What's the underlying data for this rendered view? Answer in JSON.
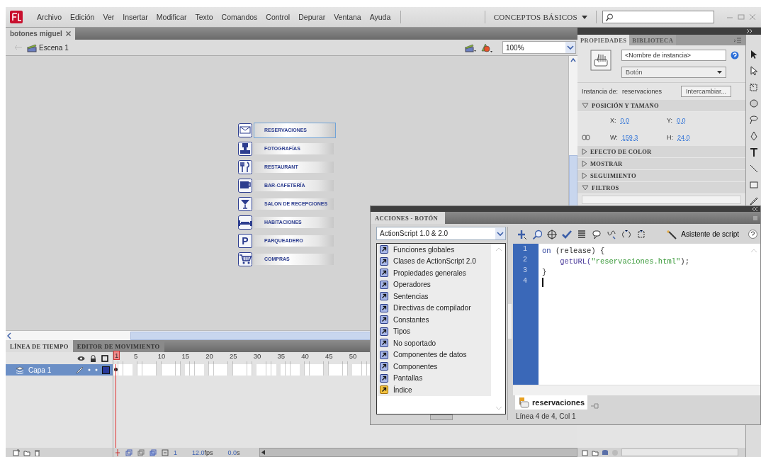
{
  "menubar": {
    "menus": [
      "Archivo",
      "Edición",
      "Ver",
      "Insertar",
      "Modificar",
      "Texto",
      "Comandos",
      "Control",
      "Depurar",
      "Ventana",
      "Ayuda"
    ],
    "workspace": "CONCEPTOS BÁSICOS"
  },
  "document_tabs": [
    {
      "label": "botones miguel",
      "selected": true
    }
  ],
  "edit_bar": {
    "scene": "Escena 1",
    "zoom": "100%"
  },
  "stage": {
    "buttons": [
      {
        "label": "RESERVACIONES",
        "kind": "envelope",
        "selected": true
      },
      {
        "label": "FOTOGRAFÍAS",
        "kind": "trophy",
        "selected": false
      },
      {
        "label": "RESTAURANT",
        "kind": "cutlery",
        "selected": false
      },
      {
        "label": "BAR-CAFETERÍA",
        "kind": "cup",
        "selected": false
      },
      {
        "label": "SALON DE RECEPCIONES",
        "kind": "cocktail",
        "selected": false
      },
      {
        "label": "HABITACIONES",
        "kind": "bed",
        "selected": false
      },
      {
        "label": "PARQUEADERO",
        "kind": "letter",
        "icon_text": "P",
        "selected": false
      },
      {
        "label": "COMPRAS",
        "kind": "cart",
        "selected": false
      }
    ]
  },
  "timeline": {
    "tabs": [
      {
        "label": "LÍNEA DE TIEMPO",
        "selected": true
      },
      {
        "label": "EDITOR DE MOVIMIENTO",
        "selected": false
      }
    ],
    "frame_numbers": [
      {
        "label": "1",
        "playhead": true
      },
      {
        "label": "5",
        "playhead": false
      },
      {
        "label": "10",
        "playhead": false
      },
      {
        "label": "15",
        "playhead": false
      },
      {
        "label": "20",
        "playhead": false
      },
      {
        "label": "25",
        "playhead": false
      },
      {
        "label": "30",
        "playhead": false
      },
      {
        "label": "35",
        "playhead": false
      },
      {
        "label": "40",
        "playhead": false
      },
      {
        "label": "45",
        "playhead": false
      },
      {
        "label": "50",
        "playhead": false
      }
    ],
    "layers": [
      {
        "name": "Capa 1",
        "selected": true,
        "color": "#27389a"
      }
    ],
    "current_frame": "1",
    "frame_rate": "12.0",
    "frame_rate_unit": "fps",
    "elapsed": "0.0",
    "elapsed_unit": "s"
  },
  "properties_panel": {
    "tabs": [
      {
        "label": "PROPIEDADES",
        "selected": true
      },
      {
        "label": "BIBLIOTECA",
        "selected": false
      }
    ],
    "instance_name": {
      "placeholder": "<Nombre de instancia>"
    },
    "symbol_type": "Botón",
    "instance_of_label": "Instancia de:",
    "instance_of": "reservaciones",
    "swap_button": "Intercambiar...",
    "sections": [
      {
        "title": "POSICIÓN Y TAMAÑO",
        "expanded": true,
        "rows": [
          {
            "kind": "position",
            "fields": [
              {
                "label": "X:",
                "value": "0.0"
              },
              {
                "label": "Y:",
                "value": "0.0"
              }
            ]
          },
          {
            "kind": "size",
            "fields": [
              {
                "label": "W:",
                "value": "159.3"
              },
              {
                "label": "H:",
                "value": "24.0"
              }
            ]
          }
        ]
      },
      {
        "title": "EFECTO DE COLOR",
        "expanded": false
      },
      {
        "title": "MOSTRAR",
        "expanded": false
      },
      {
        "title": "SEGUIMIENTO",
        "expanded": false
      },
      {
        "title": "FILTROS",
        "expanded": true
      }
    ]
  },
  "actions_panel": {
    "title": "ACCIONES - BOTÓN",
    "language": "ActionScript 1.0 & 2.0",
    "toolbox": [
      {
        "label": "Funciones globales",
        "kind": "book"
      },
      {
        "label": "Clases de ActionScript 2.0",
        "kind": "book"
      },
      {
        "label": "Propiedades generales",
        "kind": "book"
      },
      {
        "label": "Operadores",
        "kind": "book"
      },
      {
        "label": "Sentencias",
        "kind": "book"
      },
      {
        "label": "Directivas de compilador",
        "kind": "book"
      },
      {
        "label": "Constantes",
        "kind": "book"
      },
      {
        "label": "Tipos",
        "kind": "book"
      },
      {
        "label": "No soportado",
        "kind": "book"
      },
      {
        "label": "Componentes de datos",
        "kind": "book"
      },
      {
        "label": "Componentes",
        "kind": "book"
      },
      {
        "label": "Pantallas",
        "kind": "book"
      },
      {
        "label": "Índice",
        "kind": "index"
      }
    ],
    "script_assist": "Asistente de script",
    "code": [
      {
        "number": "1",
        "cursor": false,
        "parts": [
          {
            "text": "on",
            "kind": "keyword"
          },
          {
            "text": " (release) {",
            "kind": "plain"
          }
        ]
      },
      {
        "number": "2",
        "cursor": false,
        "parts": [
          {
            "text": "    getURL(",
            "kind": "function"
          },
          {
            "text": "\"reservaciones.html\"",
            "kind": "string"
          },
          {
            "text": ");",
            "kind": "plain"
          }
        ]
      },
      {
        "number": "3",
        "cursor": false,
        "parts": [
          {
            "text": "}",
            "kind": "plain"
          }
        ]
      },
      {
        "number": "4",
        "cursor": true
      }
    ],
    "script_tab": "reservaciones",
    "status": "Línea 4 de 4, Col 1"
  }
}
